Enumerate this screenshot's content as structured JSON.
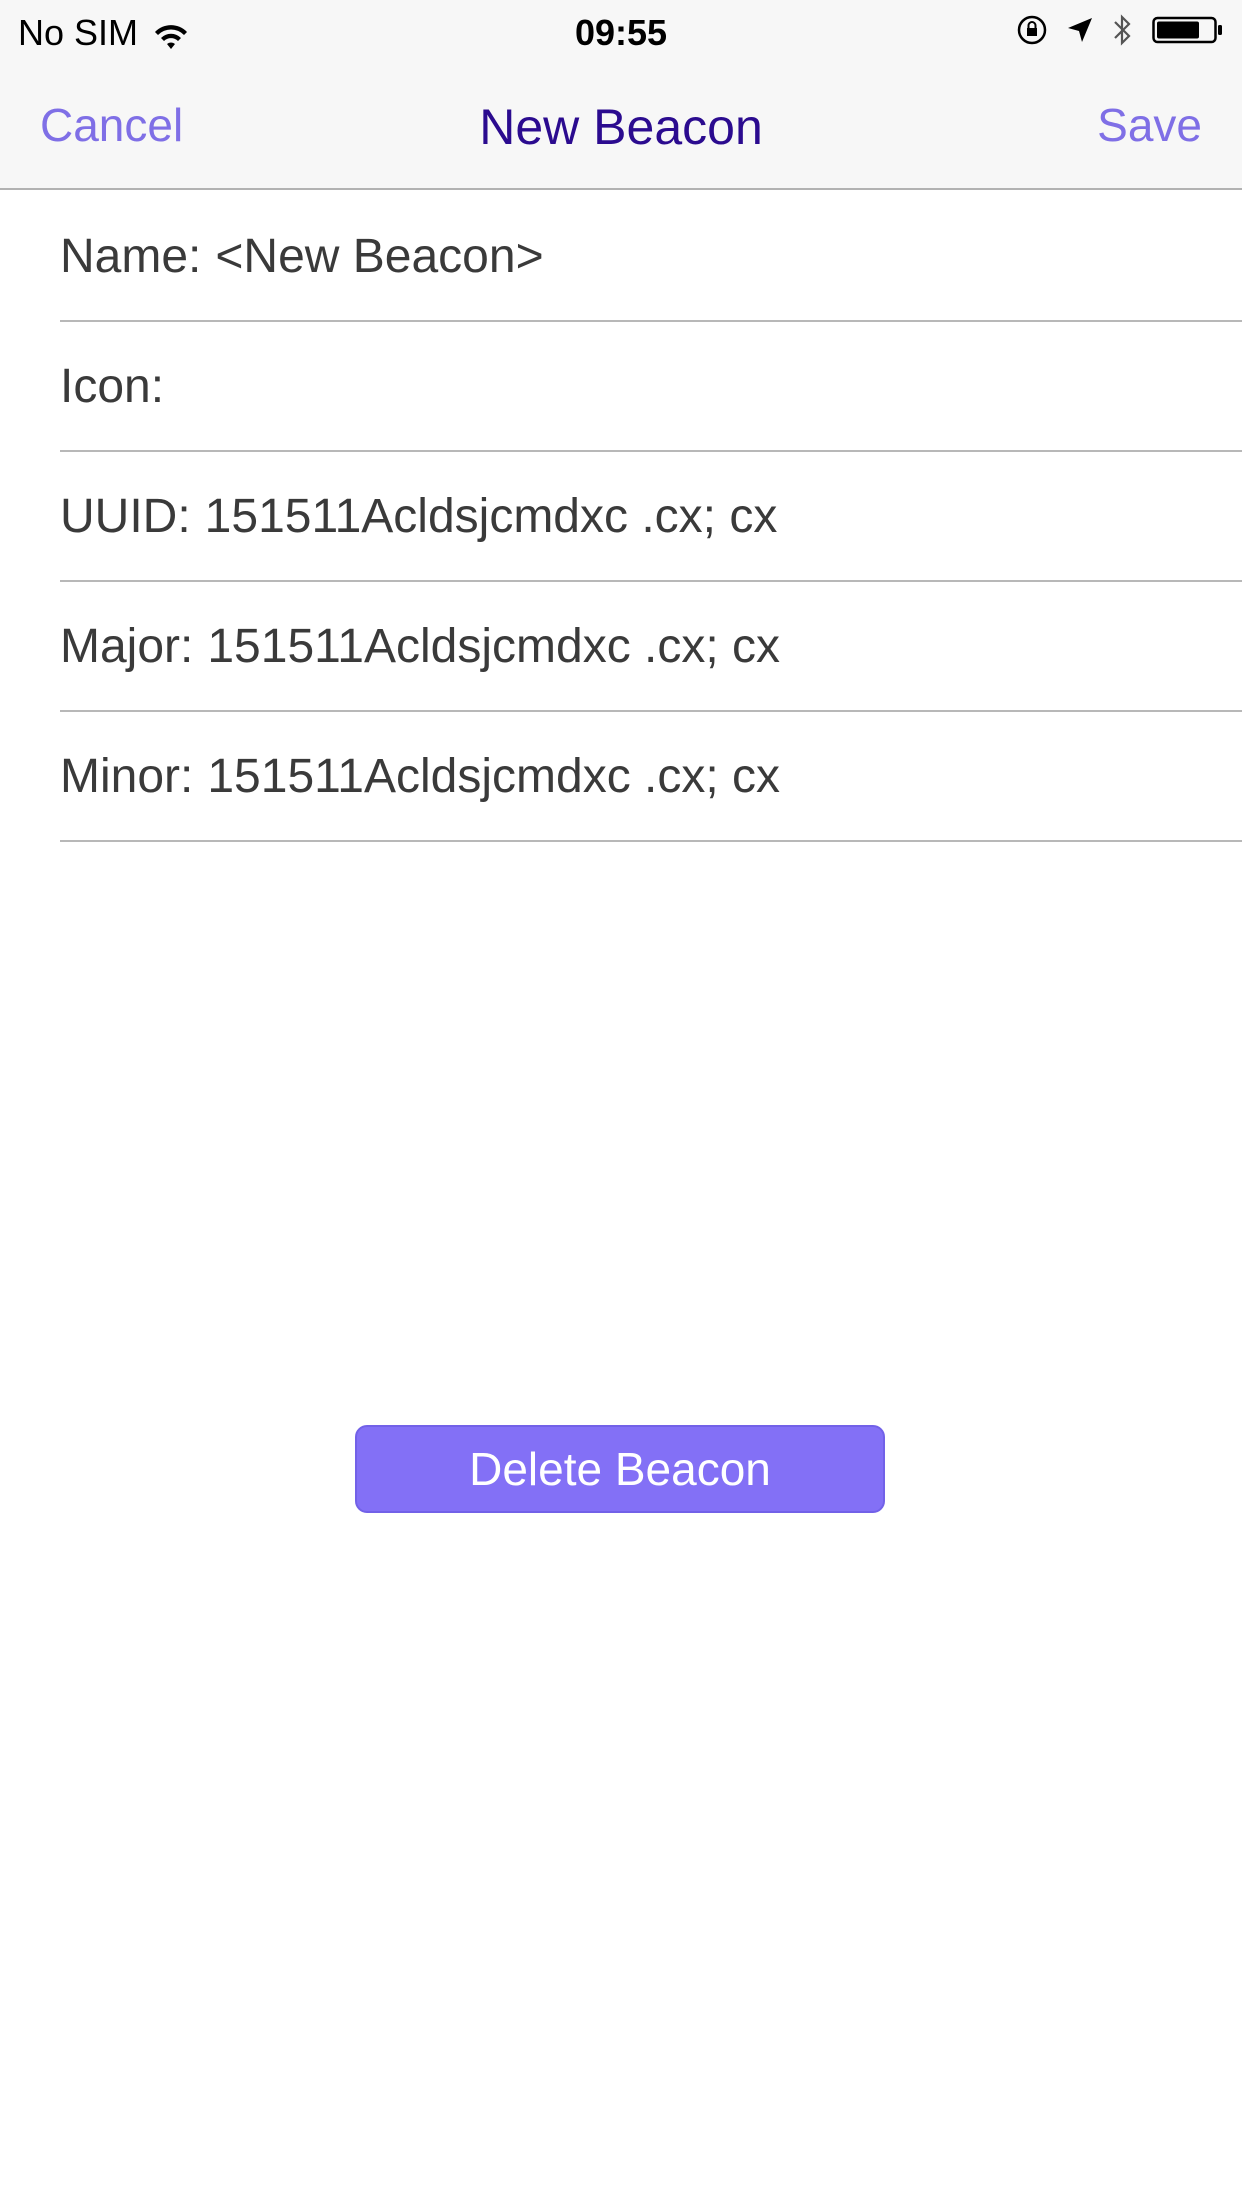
{
  "status_bar": {
    "carrier": "No SIM",
    "time": "09:55",
    "icons": [
      "wifi-icon",
      "orientation-lock-icon",
      "location-arrow-icon",
      "bluetooth-icon",
      "battery-icon"
    ]
  },
  "nav": {
    "cancel_label": "Cancel",
    "title": "New Beacon",
    "save_label": "Save"
  },
  "form": {
    "name": {
      "label": "Name:",
      "value": "<New Beacon>"
    },
    "icon": {
      "label": "Icon:",
      "value": ""
    },
    "uuid": {
      "label": "UUID:",
      "value": "151511Acldsjcmdxc .cx; cx"
    },
    "major": {
      "label": "Major:",
      "value": "151511Acldsjcmdxc .cx; cx"
    },
    "minor": {
      "label": "Minor:",
      "value": "151511Acldsjcmdxc .cx; cx"
    }
  },
  "delete_button_label": "Delete Beacon",
  "colors": {
    "accent": "#7f6fe6",
    "title": "#2b0b8f",
    "button_bg": "#8370f6"
  }
}
